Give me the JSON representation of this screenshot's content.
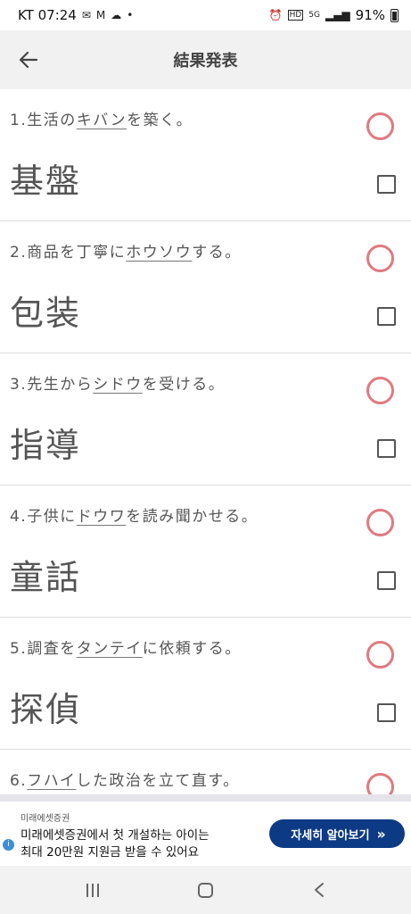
{
  "status_bar": {
    "carrier_time": "KT 07:24",
    "battery_percent": "91%",
    "icons": [
      "mail-icon",
      "gmail-icon",
      "cloud-icon",
      "dot-icon",
      "alarm-icon",
      "hd-icon",
      "5g-icon",
      "signal-icon",
      "battery-icon"
    ]
  },
  "header": {
    "title": "結果発表",
    "back_icon": "arrow-left-icon"
  },
  "items": [
    {
      "q_pre": "1.生活の",
      "q_kana": "キバン",
      "q_post": "を築く。",
      "answer": "基盤"
    },
    {
      "q_pre": "2.商品を丁寧に",
      "q_kana": "ホウソウ",
      "q_post": "する。",
      "answer": "包装"
    },
    {
      "q_pre": "3.先生から",
      "q_kana": "シドウ",
      "q_post": "を受ける。",
      "answer": "指導"
    },
    {
      "q_pre": "4.子供に",
      "q_kana": "ドウワ",
      "q_post": "を読み聞かせる。",
      "answer": "童話"
    },
    {
      "q_pre": "5.調査を",
      "q_kana": "タンテイ",
      "q_post": "に依頼する。",
      "answer": "探偵"
    },
    {
      "q_pre": "6.",
      "q_kana": "フハイ",
      "q_post": "した政治を立て直す。",
      "answer": ""
    }
  ],
  "colors": {
    "correct_mark": "#e07a80",
    "ad_button": "#0d3a85"
  },
  "ad": {
    "sponsor": "미래에셋증권",
    "line1": "미래에셋증권에서 첫 개설하는 아이는",
    "line2": "최대 20만원 지원금 받을 수 있어요",
    "cta": "자세히 알아보기",
    "cta_icon": "double-chevron-right-icon"
  },
  "nav": {
    "icons": [
      "recent-apps-icon",
      "home-icon",
      "back-icon"
    ]
  }
}
